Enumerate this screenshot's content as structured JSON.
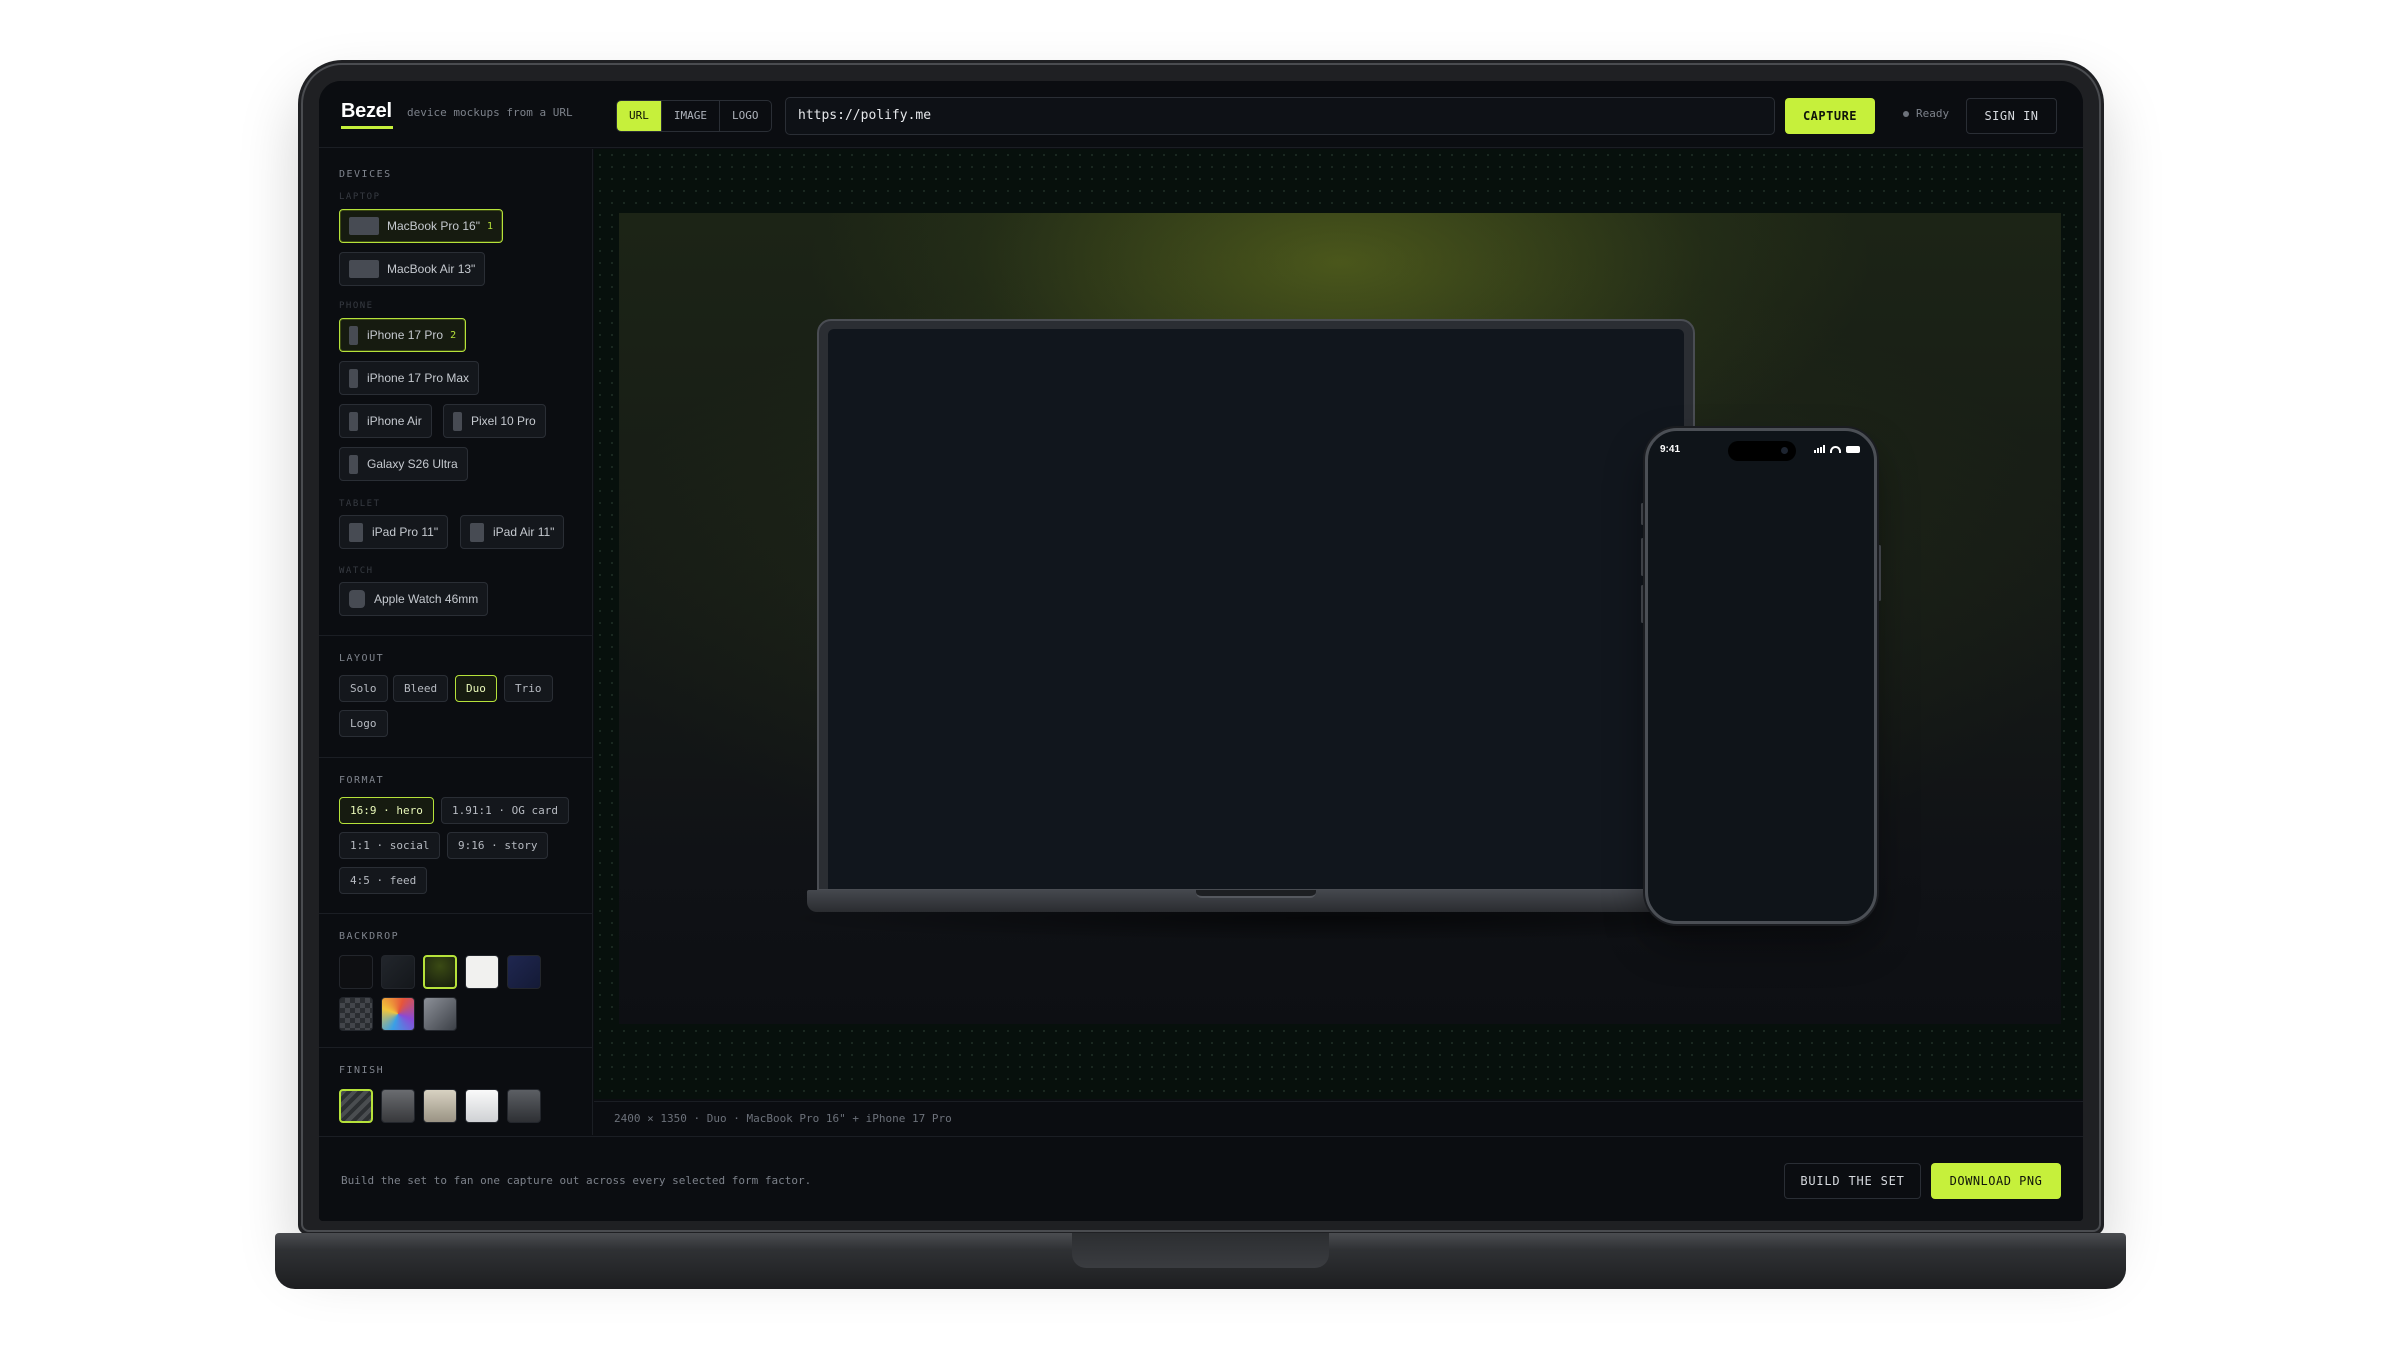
{
  "app": {
    "brand": "Bezel",
    "tagline": "device mockups from a URL"
  },
  "source_tabs": [
    {
      "label": "URL",
      "active": true
    },
    {
      "label": "IMAGE",
      "active": false
    },
    {
      "label": "LOGO",
      "active": false
    }
  ],
  "url_input": {
    "value": "https://polify.me"
  },
  "header": {
    "capture_label": "CAPTURE",
    "status_text": "Ready",
    "signin_label": "SIGN IN"
  },
  "sidebar": {
    "devices": {
      "title": "DEVICES",
      "groups": [
        {
          "label": "LAPTOP",
          "items": [
            {
              "label": "MacBook Pro 16\"",
              "selected": true,
              "count": "1",
              "icon": "laptop-thumb-icon"
            },
            {
              "label": "MacBook Air 13\"",
              "selected": false,
              "icon": "laptop-thumb-icon"
            }
          ]
        },
        {
          "label": "PHONE",
          "items": [
            {
              "label": "iPhone 17 Pro",
              "selected": true,
              "count": "2",
              "icon": "phone-thumb-icon"
            },
            {
              "label": "iPhone 17 Pro Max",
              "selected": false,
              "icon": "phone-thumb-icon"
            },
            {
              "label": "iPhone Air",
              "selected": false,
              "icon": "phone-thumb-icon"
            },
            {
              "label": "Pixel 10 Pro",
              "selected": false,
              "icon": "phone-thumb-icon"
            },
            {
              "label": "Galaxy S26 Ultra",
              "selected": false,
              "icon": "phone-thumb-icon"
            }
          ]
        },
        {
          "label": "TABLET",
          "items": [
            {
              "label": "iPad Pro 11\"",
              "selected": false,
              "icon": "tablet-thumb-icon"
            },
            {
              "label": "iPad Air 11\"",
              "selected": false,
              "icon": "tablet-thumb-icon"
            }
          ]
        },
        {
          "label": "WATCH",
          "items": [
            {
              "label": "Apple Watch 46mm",
              "selected": false,
              "icon": "watch-thumb-icon"
            }
          ]
        }
      ]
    },
    "layout": {
      "title": "LAYOUT",
      "options": [
        {
          "label": "Solo",
          "selected": false
        },
        {
          "label": "Bleed",
          "selected": false
        },
        {
          "label": "Duo",
          "selected": true
        },
        {
          "label": "Trio",
          "selected": false
        },
        {
          "label": "Logo",
          "selected": false
        }
      ]
    },
    "format": {
      "title": "FORMAT",
      "options": [
        {
          "label": "16:9 · hero",
          "selected": true
        },
        {
          "label": "1.91:1 · OG card",
          "selected": false
        },
        {
          "label": "1:1 · social",
          "selected": false
        },
        {
          "label": "9:16 · story",
          "selected": false
        },
        {
          "label": "4:5 · feed",
          "selected": false
        }
      ]
    },
    "backdrop": {
      "title": "BACKDROP",
      "swatches": [
        {
          "name": "black",
          "color": "#0e0f12",
          "selected": false
        },
        {
          "name": "charcoal",
          "color": "#1a1d22",
          "selected": false
        },
        {
          "name": "lime-glow",
          "color": "#1e2a0f",
          "selected": true
        },
        {
          "name": "white",
          "color": "#f1f1ef",
          "selected": false
        },
        {
          "name": "navy",
          "color": "#1b2244",
          "selected": false
        },
        {
          "name": "checker",
          "color": "#3a3d42",
          "selected": false
        },
        {
          "name": "rainbow",
          "color": "#e2a43a",
          "selected": false
        },
        {
          "name": "gray-gradient",
          "color": "#5c6068",
          "selected": false
        }
      ]
    },
    "finish": {
      "title": "FINISH",
      "swatches": [
        {
          "name": "auto",
          "color": "#3a3d40",
          "selected": true
        },
        {
          "name": "space-black",
          "color": "#505256",
          "selected": false
        },
        {
          "name": "gold",
          "color": "#b9b2a2",
          "selected": false
        },
        {
          "name": "silver",
          "color": "#e9eaec",
          "selected": false
        },
        {
          "name": "graphite",
          "color": "#44474c",
          "selected": false
        }
      ]
    }
  },
  "preview": {
    "phone_time": "9:41",
    "caption": "2400 × 1350 · Duo · MacBook Pro 16\" + iPhone 17 Pro"
  },
  "footer": {
    "note": "Build the set to fan one capture out across every selected form factor.",
    "build_label": "BUILD THE SET",
    "download_label": "DOWNLOAD PNG"
  },
  "colors": {
    "accent": "#c6f03b",
    "background": "#0b0d11",
    "border": "#2a2e35"
  }
}
